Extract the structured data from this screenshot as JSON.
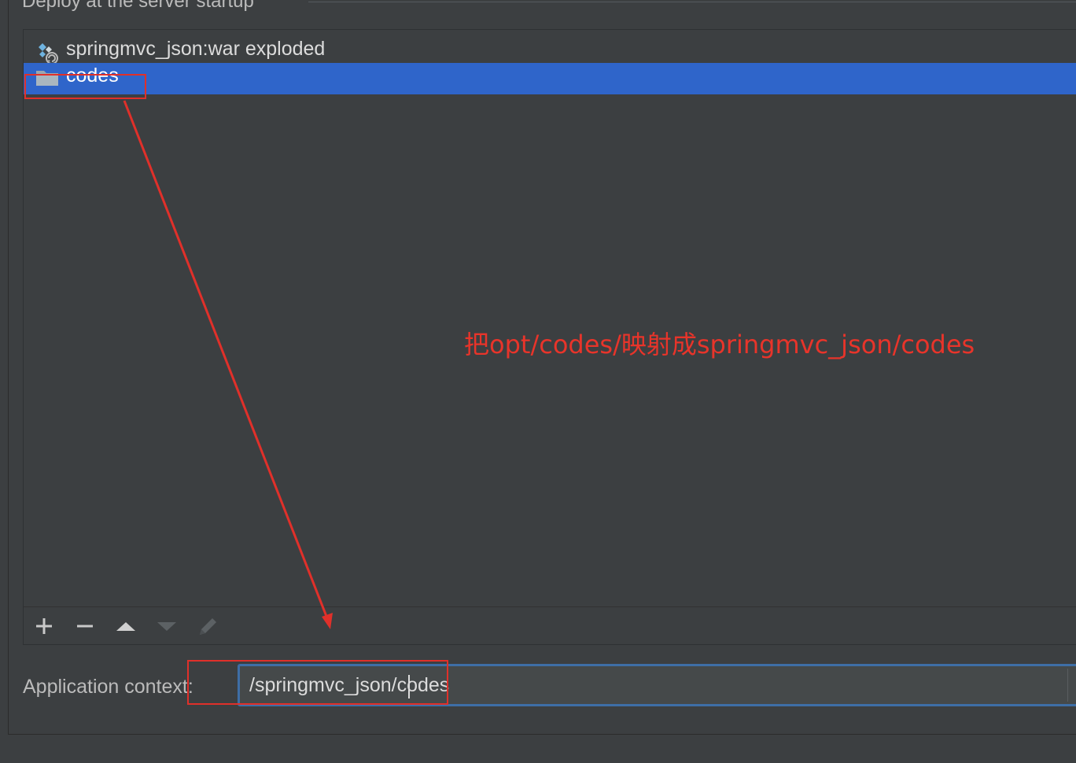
{
  "deploy_group": {
    "title": "Deploy at the server startup"
  },
  "deploy_list": {
    "items": [
      {
        "label": "springmvc_json:war exploded",
        "icon": "artifact-war-exploded-icon",
        "selected": false
      },
      {
        "label": "codes",
        "icon": "folder-icon",
        "selected": true
      }
    ]
  },
  "toolbar": {
    "buttons": [
      {
        "icon": "add-icon",
        "enabled": true
      },
      {
        "icon": "remove-icon",
        "enabled": true
      },
      {
        "icon": "move-up-icon",
        "enabled": true
      },
      {
        "icon": "move-down-icon",
        "enabled": false
      },
      {
        "icon": "edit-icon",
        "enabled": false
      }
    ]
  },
  "application_context": {
    "label": "Application context:",
    "value": "/springmvc_json/codes"
  },
  "annotation": {
    "text": "把opt/codes/映射成springmvc_json/codes",
    "color": "#e8342a"
  },
  "colors": {
    "background": "#3c3f41",
    "selection": "#2f65ca",
    "focus_border": "#3e6ea6",
    "annotation": "#e8342a"
  }
}
